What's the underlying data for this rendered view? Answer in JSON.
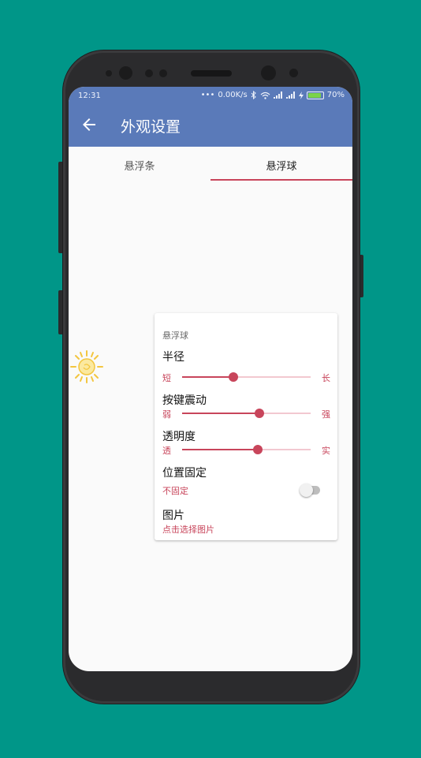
{
  "status_bar": {
    "time": "12:31",
    "net_speed": "0.00K/s",
    "battery": "70%"
  },
  "app_bar": {
    "title": "外观设置"
  },
  "tabs": [
    {
      "label": "悬浮条",
      "selected": false
    },
    {
      "label": "悬浮球",
      "selected": true
    }
  ],
  "card": {
    "subtitle": "悬浮球",
    "radius": {
      "label": "半径",
      "min_label": "短",
      "max_label": "长",
      "level": 0.4
    },
    "vibration": {
      "label": "按键震动",
      "min_label": "弱",
      "max_label": "强",
      "level": 0.6
    },
    "opacity": {
      "label": "透明度",
      "min_label": "透",
      "max_label": "实",
      "level": 0.59
    },
    "position_fixed": {
      "label": "位置固定",
      "value": "不固定",
      "on": false
    },
    "image": {
      "label": "图片",
      "value": "点击选择图片"
    }
  },
  "colors": {
    "app_bar": "#5a7ab9",
    "accent": "#c8455b",
    "page_background": "#009688"
  },
  "icons": {
    "back": "arrow-left-icon",
    "floating_ball": "sun-icon"
  }
}
